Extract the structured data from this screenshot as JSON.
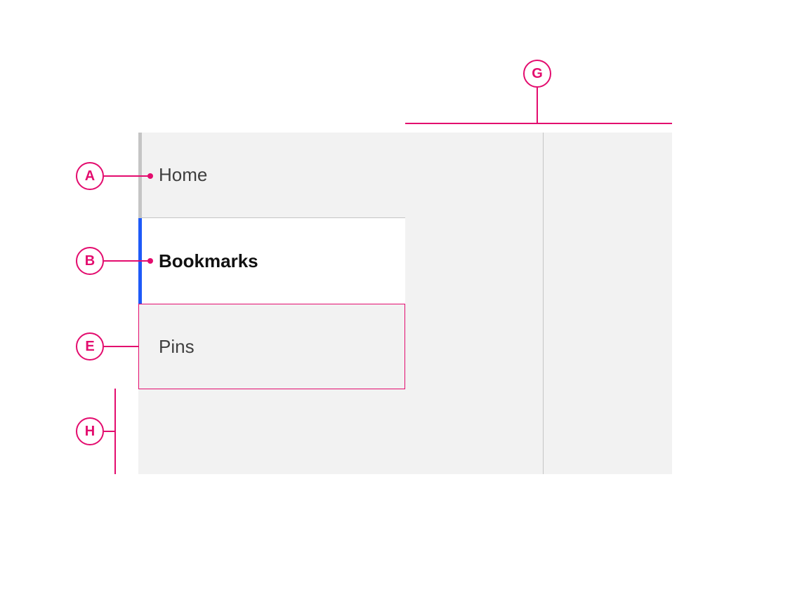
{
  "nav": {
    "items": [
      {
        "label": "Home",
        "state": "default"
      },
      {
        "label": "Bookmarks",
        "state": "active"
      },
      {
        "label": "Pins",
        "state": "outlined"
      }
    ]
  },
  "callouts": {
    "A": "A",
    "B": "B",
    "E": "E",
    "G": "G",
    "H": "H"
  },
  "colors": {
    "accent_callout": "#e30c6e",
    "accent_active": "#1e5af8",
    "panel_bg": "#f2f2f2",
    "border_neutral": "#c5c5c5"
  }
}
